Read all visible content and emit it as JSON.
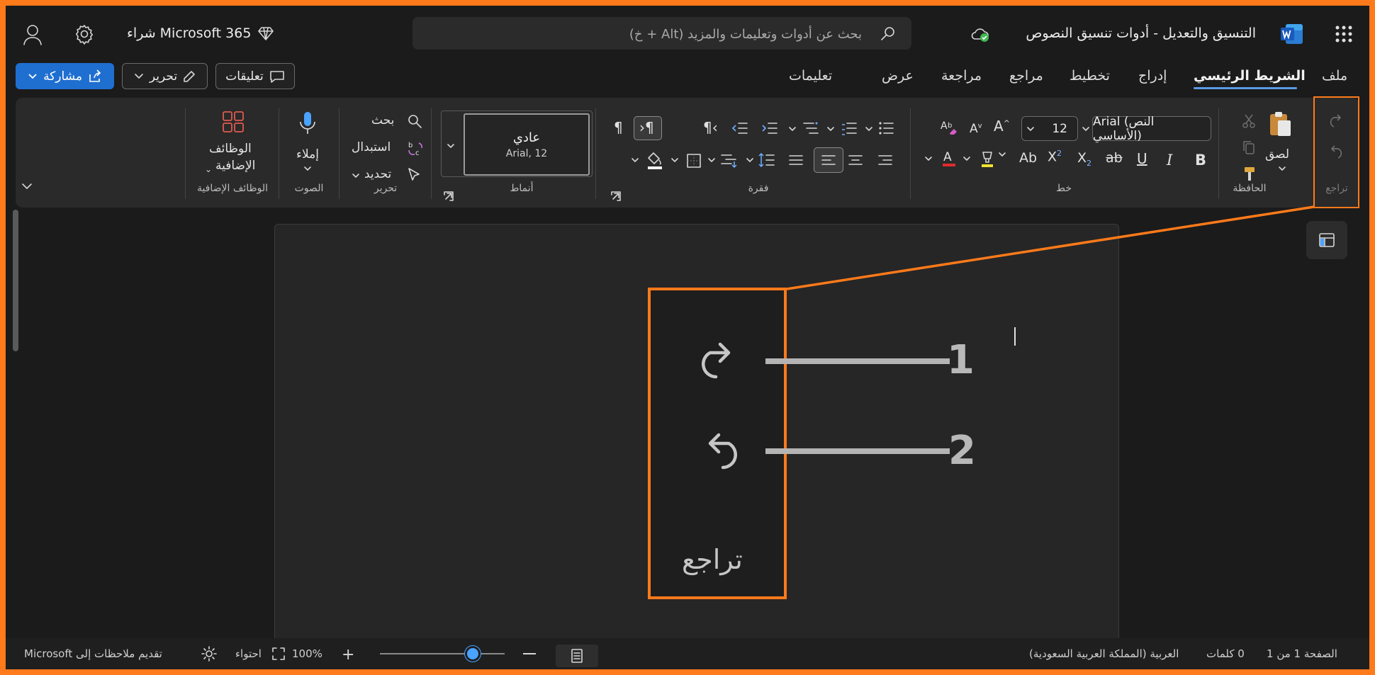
{
  "titlebar": {
    "doc_title": "التنسيق والتعديل - أدوات تنسيق النصوص",
    "search_placeholder": "بحث عن أدوات وتعليمات والمزيد (Alt + خ)",
    "buy_label": "شراء Microsoft 365"
  },
  "tabs": [
    {
      "label": "ملف"
    },
    {
      "label": "الشريط الرئيسي"
    },
    {
      "label": "إدراج"
    },
    {
      "label": "تخطيط"
    },
    {
      "label": "مراجع"
    },
    {
      "label": "مراجعة"
    },
    {
      "label": "عرض"
    },
    {
      "label": "تعليمات"
    }
  ],
  "actions": {
    "comments": "تعليقات",
    "edit": "تحرير",
    "share": "مشاركة"
  },
  "ribbon": {
    "groups": {
      "undo": "تراجع",
      "clipboard": "الحافظة",
      "font": "خط",
      "paragraph": "فقرة",
      "styles": "أنماط",
      "editing": "تحرير",
      "voice": "الصوت",
      "addins": "الوظائف الإضافية"
    },
    "paste_label": "لصق",
    "font_name": "Arial (النص الأساسي)",
    "font_size": "12",
    "style_name": "عادي",
    "style_font": "Arial, 12",
    "find_label": "بحث",
    "replace_label": "استبدال",
    "select_label": "تحديد",
    "dictate_label": "إملاء",
    "addins_line1": "الوظائف",
    "addins_line2": "الإضافية"
  },
  "callout": {
    "group_label": "تراجع",
    "number_1": "1",
    "number_2": "2"
  },
  "statusbar": {
    "page": "الصفحة 1 من 1",
    "words": "0 كلمات",
    "language": "العربية (المملكة العربية السعودية)",
    "zoom": "100%",
    "fit": "احتواء",
    "feedback": "تقديم ملاحظات إلى Microsoft"
  },
  "colors": {
    "accent": "#1f6fd1",
    "highlight_orange": "#ff7a1a",
    "ribbon_bg": "#2a2a2a"
  }
}
